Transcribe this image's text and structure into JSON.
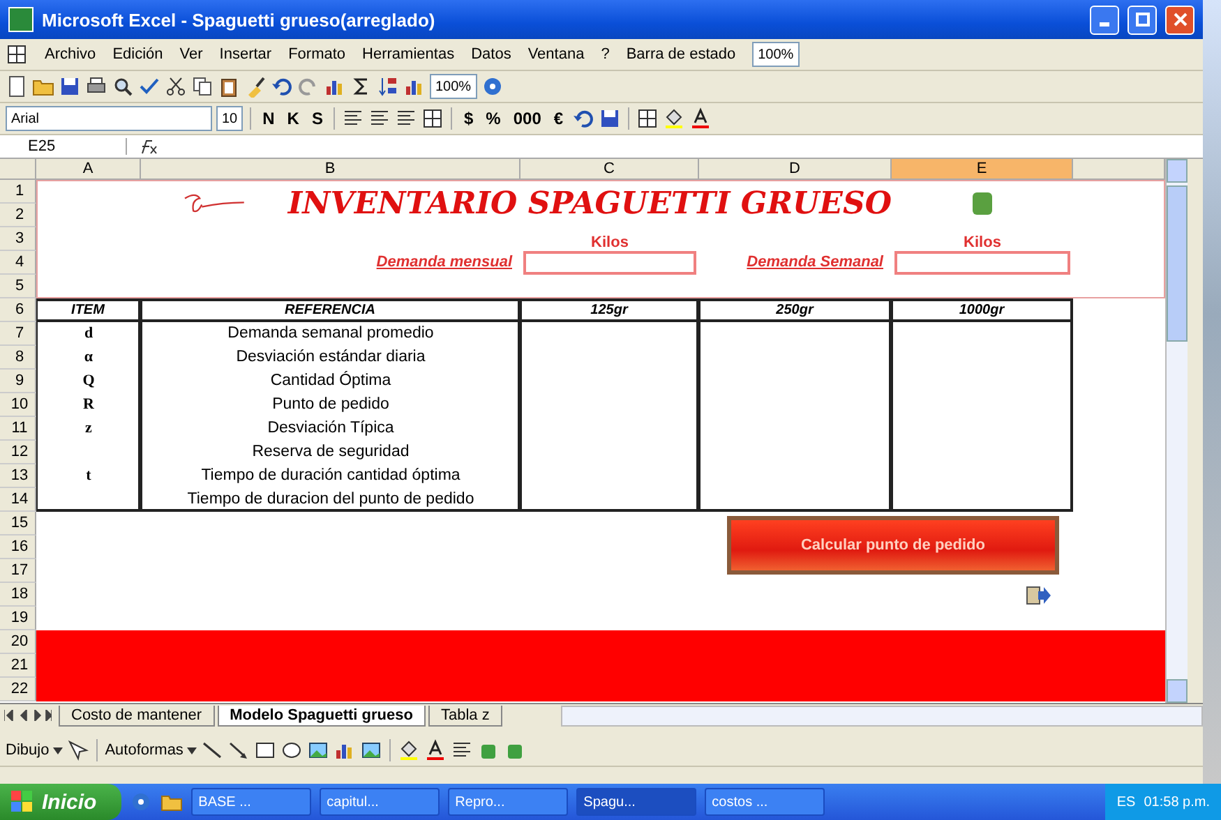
{
  "window": {
    "title": "Microsoft Excel - Spaguetti grueso(arreglado)"
  },
  "menu": {
    "items": [
      "Archivo",
      "Edición",
      "Ver",
      "Insertar",
      "Formato",
      "Herramientas",
      "Datos",
      "Ventana",
      "?",
      "Barra de estado"
    ],
    "zoom": "100%"
  },
  "standard_toolbar": {
    "zoom": "100%"
  },
  "format_toolbar": {
    "font": "Arial",
    "size": "10",
    "style_buttons": [
      "N",
      "K",
      "S"
    ],
    "number_buttons": [
      "$",
      "%",
      "000",
      "€"
    ]
  },
  "formula_bar": {
    "name_box": "E25"
  },
  "columns": [
    {
      "label": "A",
      "selected": false
    },
    {
      "label": "B",
      "selected": false
    },
    {
      "label": "C",
      "selected": false
    },
    {
      "label": "D",
      "selected": false
    },
    {
      "label": "E",
      "selected": true
    }
  ],
  "rows": [
    "1",
    "2",
    "3",
    "4",
    "5",
    "6",
    "7",
    "8",
    "9",
    "10",
    "11",
    "12",
    "13",
    "14",
    "15",
    "16",
    "17",
    "18",
    "19",
    "20",
    "21",
    "22"
  ],
  "sheet": {
    "title": "INVENTARIO SPAGUETTI GRUESO",
    "units": [
      "Kilos",
      "Kilos"
    ],
    "fields": [
      {
        "label": "Demanda mensual"
      },
      {
        "label": "Demanda Semanal"
      }
    ],
    "table": {
      "columns": [
        "ITEM",
        "REFERENCIA",
        "125gr",
        "250gr",
        "1000gr"
      ],
      "rows": [
        {
          "item": "d",
          "reference": "Demanda semanal promedio"
        },
        {
          "item": "α",
          "reference": "Desviación estándar diaria"
        },
        {
          "item": "Q",
          "reference": "Cantidad Óptima"
        },
        {
          "item": "R",
          "reference": "Punto de pedido"
        },
        {
          "item": "z",
          "reference": "Desviación Típica"
        },
        {
          "reference": "Reserva de seguridad"
        },
        {
          "item": "t",
          "reference": "Tiempo de duración cantidad óptima"
        },
        {
          "reference": "Tiempo de duracion del punto de pedido"
        }
      ]
    },
    "button": "Calcular punto de pedido"
  },
  "sheet_tabs": [
    {
      "label": "Costo de mantener",
      "selected": false
    },
    {
      "label": "Modelo Spaguetti grueso",
      "selected": true
    },
    {
      "label": "Tabla z",
      "selected": false
    }
  ],
  "drawing_toolbar": {
    "items": [
      "Dibujo",
      "Autoformas"
    ]
  },
  "taskbar": {
    "start": "Inicio",
    "tasks": [
      {
        "label": "BASE ...",
        "selected": false
      },
      {
        "label": "capitul...",
        "selected": false
      },
      {
        "label": "Repro...",
        "selected": false
      },
      {
        "label": "Spagu...",
        "selected": true
      },
      {
        "label": "costos ...",
        "selected": false
      }
    ],
    "language": "ES",
    "clock": "01:58 p.m."
  }
}
